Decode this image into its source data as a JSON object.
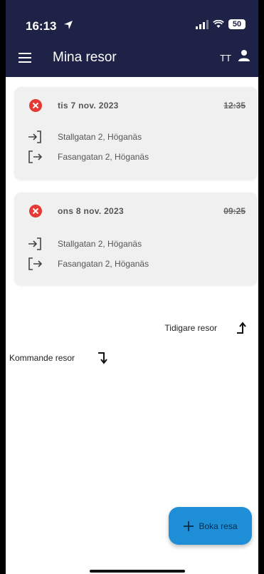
{
  "status_bar": {
    "time": "16:13",
    "battery": "50"
  },
  "header": {
    "title": "Mina resor",
    "user_initials": "TT"
  },
  "trips": [
    {
      "date": "tis 7 nov. 2023",
      "time": "12:35",
      "status": "cancelled",
      "from": "Stallgatan 2, Höganäs",
      "to": "Fasangatan 2, Höganäs"
    },
    {
      "date": "ons 8 nov. 2023",
      "time": "09:25",
      "status": "cancelled",
      "from": "Stallgatan 2, Höganäs",
      "to": "Fasangatan 2, Höganäs"
    }
  ],
  "navigation": {
    "history_label": "Tidigare resor",
    "upcoming_label": "Kommande resor"
  },
  "fab": {
    "label": "Boka resa",
    "icon": "plus-icon"
  },
  "colors": {
    "header_bg": "#1e2246",
    "cancel_red": "#e53935",
    "fab_bg": "#1e8fd6",
    "card_bg": "#f0f0f0"
  }
}
